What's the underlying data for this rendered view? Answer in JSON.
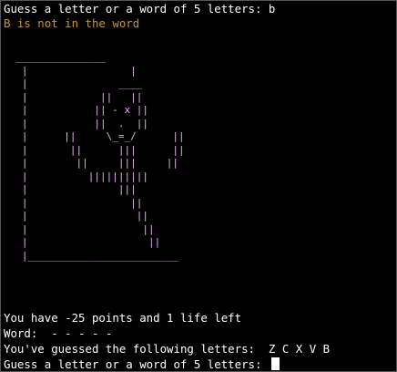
{
  "terminal": {
    "prompt_line": "Guess a letter or a word of 5 letters: b",
    "feedback_line": "B is not in the word",
    "gallows_art": "  _______________\n   |                 |\n   |               ____\n   |            ||   ||\n   |           || - x ||\n   |           ||  .  ||\n   |      ||     \\_=_/      ||\n   |       ||      |||      ||\n   |        ||     |||     ||\n   |          ||||||||||\n   |               |||\n   |                 ||\n   |                  ||\n   |                   ||\n   |                    ||\n   |_________________________",
    "status_line": "You have -25 points and 1 life left",
    "word_line": "Word:  - - - - -",
    "guessed_line": "You've guessed the following letters:  Z C X V B",
    "input_prompt": "Guess a letter or a word of 5 letters: "
  },
  "colors": {
    "background": "#000000",
    "text": "#ffffff",
    "feedback": "#c8962d",
    "gallows": "#e8b0f0"
  }
}
